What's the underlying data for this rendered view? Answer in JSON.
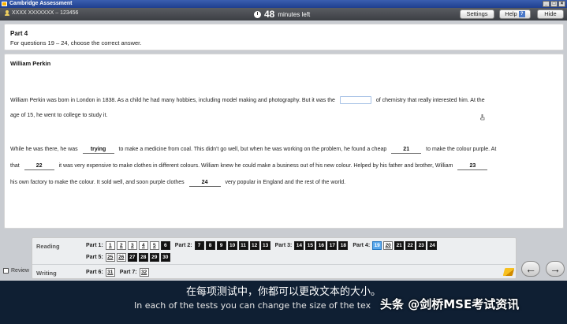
{
  "window": {
    "title": "Cambridge Assessment"
  },
  "topbar": {
    "candidate": "XXXX XXXXXXX – 123456",
    "timer_value": "48",
    "timer_unit": "minutes left",
    "settings_label": "Settings",
    "help_label": "Help",
    "hide_label": "Hide"
  },
  "instructions": {
    "part": "Part 4",
    "desc": "For questions 19 – 24, choose the correct answer."
  },
  "passage": {
    "title": "William Perkin",
    "l1a": "William Perkin was born in London in 1838. As a child he had many hobbies, including model making and photography. But it was the",
    "l1b": "of chemistry that really interested him. At the",
    "l2": "age of 15, he went to college to study it.",
    "l3a": "While he was there, he was",
    "g20": "trying",
    "l3b": "to make a medicine from coal. This didn't go well, but when he was working on the problem, he found a cheap",
    "g21": "21",
    "l3c": "to make the colour purple. At",
    "l4a": "that",
    "g22": "22",
    "l4b": "it was very expensive to make clothes in different colours. William knew he could make a business out of his new colour. Helped by his father and brother, William",
    "g23": "23",
    "l5a": "his own factory to make the colour. It sold well, and soon purple clothes",
    "g24": "24",
    "l5b": "very popular in England and the rest of the world."
  },
  "nav": {
    "reading_label": "Reading",
    "writing_label": "Writing",
    "review_label": "Review",
    "reading_parts": [
      {
        "label": "Part 1:",
        "questions": [
          {
            "n": "1",
            "state": "light"
          },
          {
            "n": "2",
            "state": "light"
          },
          {
            "n": "3",
            "state": "light"
          },
          {
            "n": "4",
            "state": "light"
          },
          {
            "n": "5",
            "state": "light"
          },
          {
            "n": "6",
            "state": "dark"
          }
        ]
      },
      {
        "label": "Part 2:",
        "questions": [
          {
            "n": "7",
            "state": "dark"
          },
          {
            "n": "8",
            "state": "dark"
          },
          {
            "n": "9",
            "state": "dark"
          },
          {
            "n": "10",
            "state": "dark"
          },
          {
            "n": "11",
            "state": "dark"
          },
          {
            "n": "12",
            "state": "dark"
          },
          {
            "n": "13",
            "state": "dark"
          }
        ]
      },
      {
        "label": "Part 3:",
        "questions": [
          {
            "n": "14",
            "state": "dark"
          },
          {
            "n": "15",
            "state": "dark"
          },
          {
            "n": "16",
            "state": "dark"
          },
          {
            "n": "17",
            "state": "dark"
          },
          {
            "n": "18",
            "state": "dark"
          }
        ]
      },
      {
        "label": "Part 4:",
        "questions": [
          {
            "n": "19",
            "state": "current"
          },
          {
            "n": "20",
            "state": "light"
          },
          {
            "n": "21",
            "state": "dark"
          },
          {
            "n": "22",
            "state": "dark"
          },
          {
            "n": "23",
            "state": "dark"
          },
          {
            "n": "24",
            "state": "dark"
          }
        ]
      }
    ],
    "reading_part5": {
      "label": "Part 5:",
      "questions": [
        {
          "n": "25",
          "state": "light"
        },
        {
          "n": "26",
          "state": "light"
        },
        {
          "n": "27",
          "state": "dark"
        },
        {
          "n": "28",
          "state": "dark"
        },
        {
          "n": "29",
          "state": "dark"
        },
        {
          "n": "30",
          "state": "dark"
        }
      ]
    },
    "writing_parts": [
      {
        "label": "Part 6:",
        "questions": [
          {
            "n": "31",
            "state": "light"
          }
        ]
      },
      {
        "label": "Part 7:",
        "questions": [
          {
            "n": "32",
            "state": "light"
          }
        ]
      }
    ]
  },
  "subtitles": {
    "zh": "在每项测试中，你都可以更改文本的大小。",
    "en": "In each of the tests you can change the size of the tex",
    "watermark": "头条 @剑桥MSE考试资讯"
  },
  "colors": {
    "current_question": "#5aa8ec",
    "answered": "#111111",
    "overlay": "#0f1f33"
  }
}
